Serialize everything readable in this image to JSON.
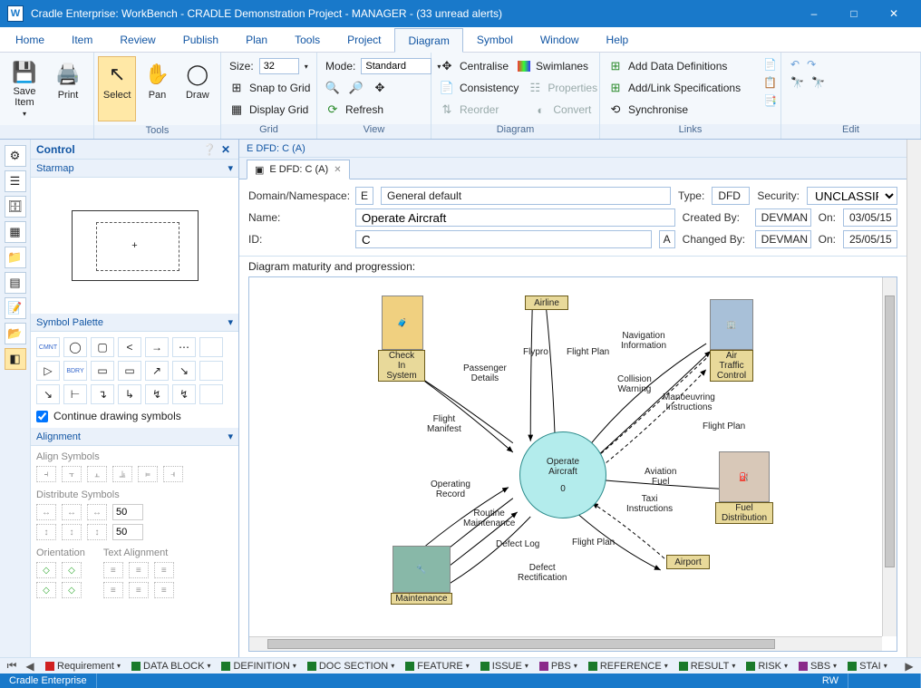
{
  "title": "Cradle Enterprise: WorkBench - CRADLE Demonstration Project - MANAGER - (33 unread alerts)",
  "app_icon_letter": "W",
  "menus": [
    "Home",
    "Item",
    "Review",
    "Publish",
    "Plan",
    "Tools",
    "Project",
    "Diagram",
    "Symbol",
    "Window",
    "Help"
  ],
  "active_menu": "Diagram",
  "ribbon": {
    "file": {
      "save_item": "Save\nItem",
      "print": "Print"
    },
    "tools": {
      "label": "Tools",
      "select": "Select",
      "pan": "Pan",
      "draw": "Draw"
    },
    "grid": {
      "label": "Grid",
      "size_lbl": "Size:",
      "size_val": "32",
      "snap": "Snap to Grid",
      "display": "Display Grid"
    },
    "view": {
      "label": "View",
      "mode_lbl": "Mode:",
      "mode_val": "Standard",
      "refresh": "Refresh"
    },
    "diagram": {
      "label": "Diagram",
      "centralise": "Centralise",
      "swimlanes": "Swimlanes",
      "consistency": "Consistency",
      "properties": "Properties",
      "reorder": "Reorder",
      "convert": "Convert"
    },
    "links": {
      "label": "Links",
      "add_dd": "Add Data Definitions",
      "add_spec": "Add/Link Specifications",
      "sync": "Synchronise"
    },
    "edit": {
      "label": "Edit"
    }
  },
  "control_panel": {
    "title": "Control",
    "starmap": "Starmap",
    "symbol_palette": "Symbol Palette",
    "continue_drawing": "Continue drawing symbols",
    "alignment": "Alignment",
    "align_symbols": "Align Symbols",
    "distribute_symbols": "Distribute Symbols",
    "orientation": "Orientation",
    "text_alignment": "Text Alignment",
    "dist_val": "50"
  },
  "editor": {
    "header": "E DFD: C (A)",
    "tab": "E DFD: C (A)",
    "domain_ns_lbl": "Domain/Namespace:",
    "domain_code": "E",
    "domain_name": "General default",
    "type_lbl": "Type:",
    "type_val": "DFD",
    "security_lbl": "Security:",
    "security_val": "UNCLASSIFIED",
    "name_lbl": "Name:",
    "name_val": "Operate Aircraft",
    "created_by_lbl": "Created By:",
    "created_by_val": "DEVMAN",
    "created_on_lbl": "On:",
    "created_on_val": "03/05/15",
    "id_lbl": "ID:",
    "id_val": "C",
    "id_suffix": "A",
    "changed_by_lbl": "Changed By:",
    "changed_by_val": "DEVMAN",
    "changed_on_lbl": "On:",
    "changed_on_val": "25/05/15",
    "maturity": "Diagram maturity and progression:"
  },
  "diagram": {
    "center": {
      "name": "Operate\nAircraft",
      "num": "0"
    },
    "externals": {
      "airline": "Airline",
      "atc": "Air\nTraffic\nControl",
      "fuel": "Fuel\nDistribution",
      "airport": "Airport",
      "maintenance": "Maintenance",
      "checkin": "Check\nIn\nSystem"
    },
    "flows": {
      "passenger_details": "Passenger\nDetails",
      "flypro": "Flypro",
      "flight_plan1": "Flight Plan",
      "nav_info": "Navigation\nInformation",
      "collision": "Collision\nWarning",
      "manoeuvring": "Manoeuvring\nInstructions",
      "flight_plan2": "Flight Plan",
      "aviation_fuel": "Aviation\nFuel",
      "taxi": "Taxi\nInstructions",
      "flight_plan3": "Flight Plan",
      "defect_rect": "Defect\nRectification",
      "defect_log": "Defect Log",
      "routine_maint": "Routine\nMaintenance",
      "op_record": "Operating\nRecord",
      "flight_manifest": "Flight\nManifest"
    }
  },
  "viewbar": {
    "items": [
      {
        "label": "Requirement",
        "color": "#d02020"
      },
      {
        "label": "DATA BLOCK",
        "color": "#1a7a2a"
      },
      {
        "label": "DEFINITION",
        "color": "#1a7a2a"
      },
      {
        "label": "DOC SECTION",
        "color": "#1a7a2a"
      },
      {
        "label": "FEATURE",
        "color": "#1a7a2a"
      },
      {
        "label": "ISSUE",
        "color": "#1a7a2a"
      },
      {
        "label": "PBS",
        "color": "#8a2a8a"
      },
      {
        "label": "REFERENCE",
        "color": "#1a7a2a"
      },
      {
        "label": "RESULT",
        "color": "#1a7a2a"
      },
      {
        "label": "RISK",
        "color": "#1a7a2a"
      },
      {
        "label": "SBS",
        "color": "#8a2a8a"
      },
      {
        "label": "STAI",
        "color": "#1a7a2a"
      }
    ]
  },
  "status": {
    "app": "Cradle Enterprise",
    "rw": "RW"
  }
}
